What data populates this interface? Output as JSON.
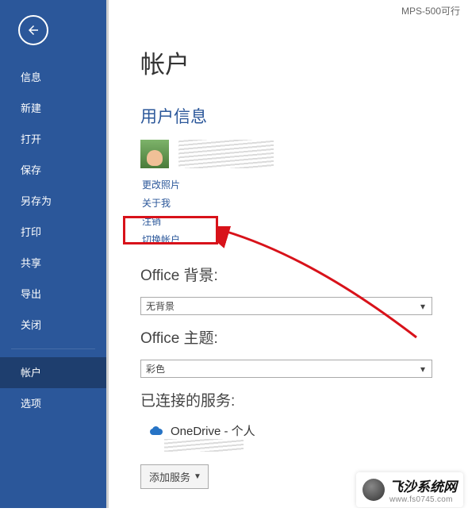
{
  "doc_title": "MPS-500可行",
  "sidebar": {
    "items": [
      {
        "label": "信息"
      },
      {
        "label": "新建"
      },
      {
        "label": "打开"
      },
      {
        "label": "保存"
      },
      {
        "label": "另存为"
      },
      {
        "label": "打印"
      },
      {
        "label": "共享"
      },
      {
        "label": "导出"
      },
      {
        "label": "关闭"
      }
    ],
    "footer": [
      {
        "label": "帐户"
      },
      {
        "label": "选项"
      }
    ]
  },
  "main": {
    "title": "帐户",
    "user_section_title": "用户信息",
    "links": {
      "change_photo": "更改照片",
      "about_me": "关于我",
      "sign_out": "注销",
      "switch_account": "切换帐户"
    },
    "background_label": "Office 背景:",
    "background_value": "无背景",
    "theme_label": "Office 主题:",
    "theme_value": "彩色",
    "services_label": "已连接的服务:",
    "onedrive_label": "OneDrive - 个人",
    "add_service_label": "添加服务"
  },
  "watermark": {
    "title": "飞沙系统网",
    "url": "www.fs0745.com"
  }
}
